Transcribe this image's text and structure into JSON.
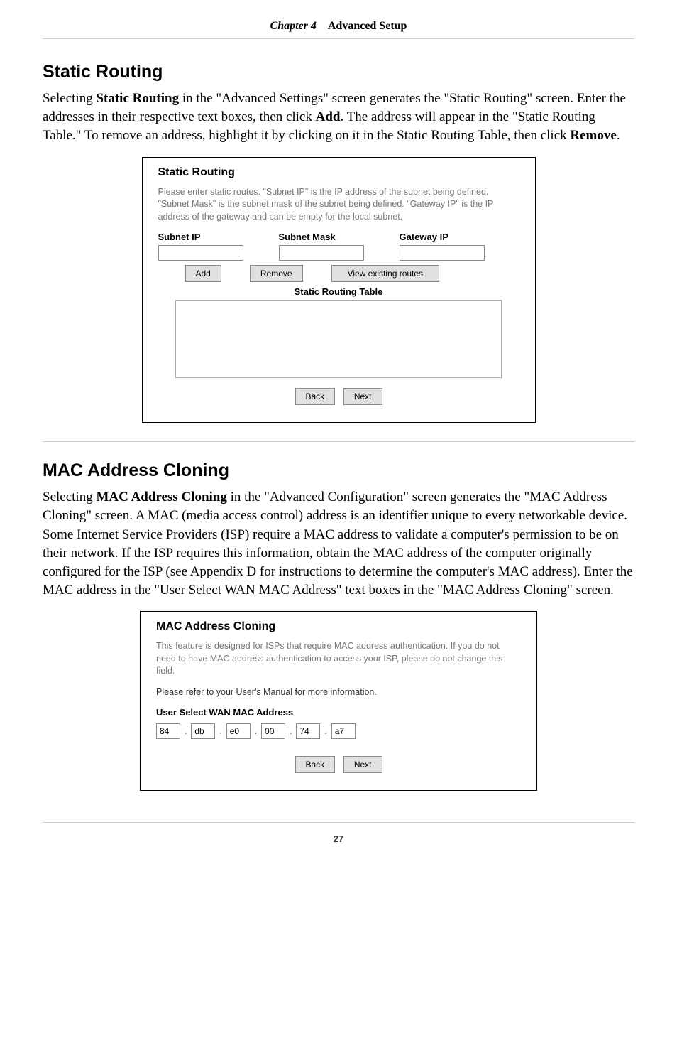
{
  "header": {
    "chapter": "Chapter 4",
    "title": "Advanced Setup"
  },
  "section1": {
    "heading": "Static Routing",
    "para_parts": {
      "p1": "Selecting ",
      "p2": "Static Routing",
      "p3": " in the \"Advanced Settings\" screen generates the \"Static Routing\" screen. Enter the addresses in their respective text boxes, then click ",
      "p4": "Add",
      "p5": ". The address will appear in the \"Static Routing Table.\" To remove an address, highlight it by clicking on it in the Static Routing Table, then click ",
      "p6": "Remove",
      "p7": "."
    },
    "shot": {
      "title": "Static Routing",
      "desc": "Please enter static routes. \"Subnet IP\" is the IP address of the subnet being defined. \"Subnet Mask\" is the subnet mask of the subnet being defined. \"Gateway IP\" is the IP address of the gateway and can be empty for the local subnet.",
      "labels": {
        "subnet_ip": "Subnet IP",
        "subnet_mask": "Subnet Mask",
        "gateway_ip": "Gateway IP"
      },
      "buttons": {
        "add": "Add",
        "remove": "Remove",
        "view": "View existing routes",
        "back": "Back",
        "next": "Next"
      },
      "table_label": "Static Routing Table"
    }
  },
  "section2": {
    "heading": "MAC Address Cloning",
    "para_parts": {
      "p1": "Selecting ",
      "p2": "MAC Address Cloning",
      "p3": " in the \"Advanced Configuration\" screen generates the \"MAC Address Cloning\" screen. A MAC (media access control) address is an identifier unique to every networkable device. Some Internet Service Providers (ISP) require a MAC address to validate a computer's permission to be on their network. If the ISP requires this information, obtain the MAC address of the computer originally configured for the ISP (see Appendix D for instructions to determine the computer's MAC address). Enter the MAC address in the \"User Select WAN MAC Address\" text boxes in the \"MAC Address Cloning\" screen."
    },
    "shot": {
      "title": "MAC Address Cloning",
      "desc1": "This feature is designed for ISPs that require MAC address authentication. If you do not need to have MAC address authentication to access your ISP, please do not change this field.",
      "desc2": "Please refer to your User's Manual for more information.",
      "label": "User Select WAN MAC Address",
      "mac": [
        "84",
        "db",
        "e0",
        "00",
        "74",
        "a7"
      ],
      "buttons": {
        "back": "Back",
        "next": "Next"
      }
    }
  },
  "footer": {
    "page": "27"
  }
}
